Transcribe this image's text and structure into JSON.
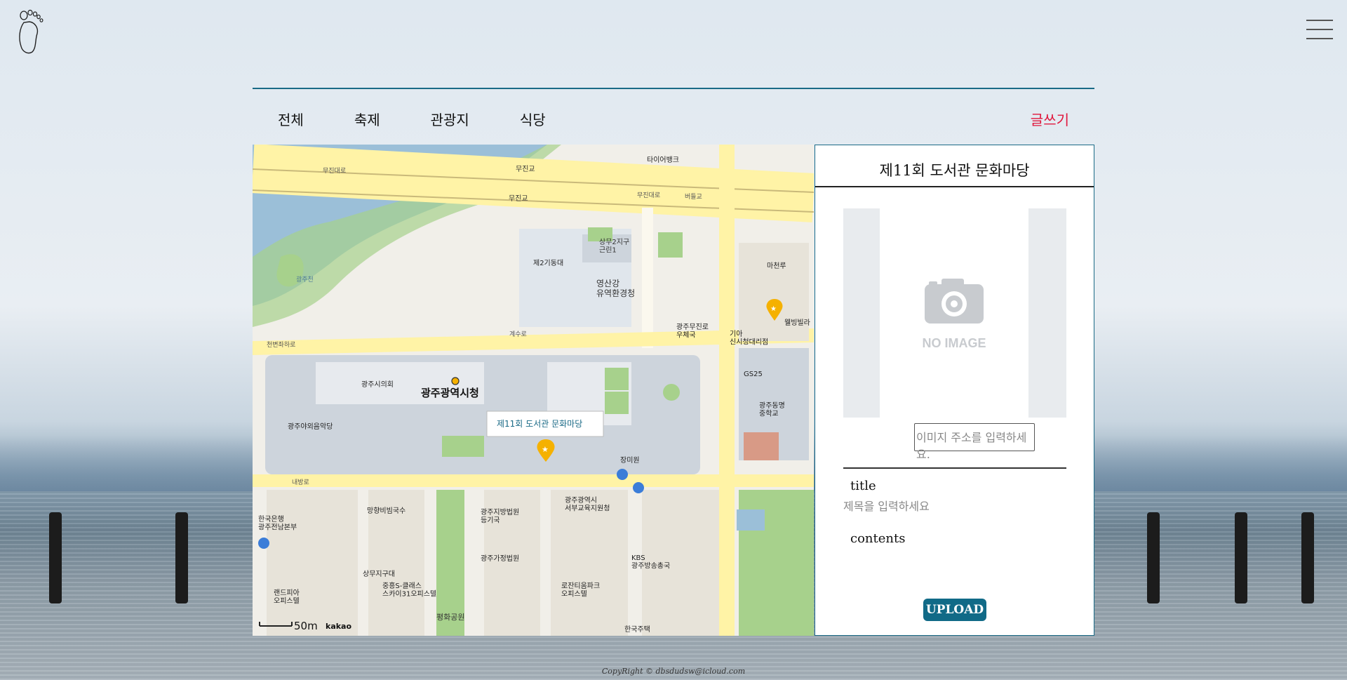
{
  "header": {
    "menu_icon": "hamburger-menu-icon",
    "logo_icon": "footprint-icon"
  },
  "tabs": [
    {
      "label": "전체"
    },
    {
      "label": "축제"
    },
    {
      "label": "관광지"
    },
    {
      "label": "식당"
    }
  ],
  "write_label": "글쓰기",
  "colors": {
    "accent": "#1a6a86",
    "write": "#e0163c",
    "upload_bg": "#116a87"
  },
  "map": {
    "info_window": "제11회 도서관 문화마당",
    "scale": "50m",
    "provider": "kakao",
    "labels": {
      "city_hall": "광주광역시청",
      "council": "광주시의회",
      "bridge1": "무진교",
      "bridge2": "무진교",
      "road1": "무진대로",
      "road2": "무진대로",
      "road3": "천변좌하로",
      "road4": "계수로",
      "road5": "내방로",
      "road6": "버들교",
      "river": "광주천",
      "tire": "타이어뱅크",
      "park1": "상무2지구\n근린1",
      "bldg1": "제2기동대",
      "env": "영산강\n유역환경청",
      "post": "광주무진로\n우체국",
      "macheonru": "마천루",
      "kia": "기아\n신시청대리점",
      "wellbing": "웰빙빌라",
      "gs25": "GS25",
      "school": "광주동명\n중학교",
      "concert": "광주야외음악당",
      "rose": "장미원",
      "bank": "한국은행\n광주전남본부",
      "noodle": "망향비빔국수",
      "court1": "광주지방법원\n등기국",
      "edu": "광주광역시\n서부교육지원청",
      "court2": "광주가정법원",
      "kbs": "KBS\n광주방송총국",
      "market": "상무지구대",
      "sky": "중흥S-클래스\n스카이31오피스텔",
      "landpia": "랜드피아\n오피스텔",
      "lotte": "로잔티움파크\n오피스텔",
      "peace": "평화공원",
      "hanguk": "한국주택"
    }
  },
  "panel": {
    "title": "제11회 도서관 문화마당",
    "no_image": "NO IMAGE",
    "camera_icon": "camera-icon",
    "url_placeholder": "이미지 주소를 입력하세요.",
    "title_label": "title",
    "title_placeholder": "제목을 입력하세요",
    "contents_label": "contents",
    "upload_label": "UPLOAD"
  },
  "footer": "CopyRight © dbsdudsw@icloud.com"
}
